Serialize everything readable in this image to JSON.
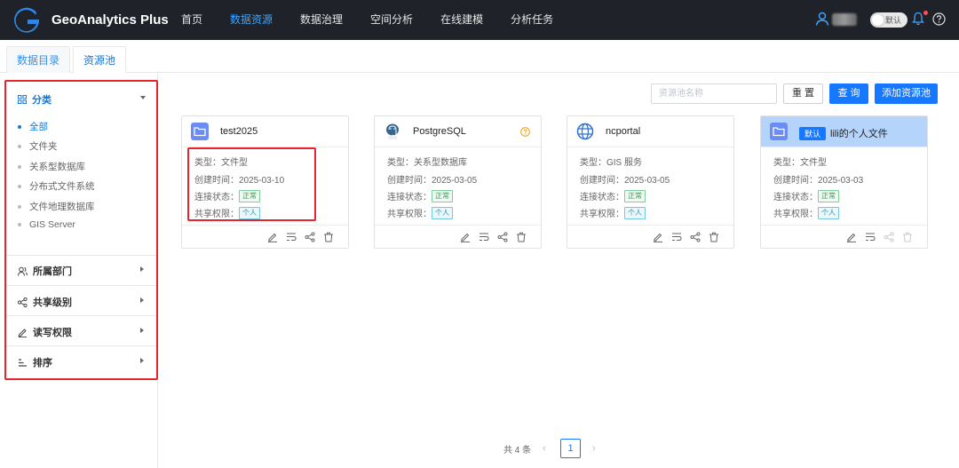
{
  "app": {
    "title": "GeoAnalytics Plus",
    "nav": [
      "首页",
      "数据资源",
      "数据治理",
      "空间分析",
      "在线建模",
      "分析任务"
    ],
    "nav_active_index": 1,
    "toggle_label": "默认"
  },
  "tabs": [
    "数据目录",
    "资源池"
  ],
  "tabs_active_index": 1,
  "sidebar": {
    "category": {
      "title": "分类",
      "items": [
        "全部",
        "文件夹",
        "关系型数据库",
        "分布式文件系统",
        "文件地理数据库",
        "GIS Server"
      ],
      "active_index": 0
    },
    "sections": [
      "所属部门",
      "共享级别",
      "读写权限",
      "排序"
    ]
  },
  "toolbar": {
    "search_placeholder": "资源池名称",
    "reset_label": "重 置",
    "query_label": "查 询",
    "add_label": "添加资源池"
  },
  "cards": [
    {
      "title": "test2025",
      "icon": "folder-icon",
      "default_badge": "",
      "type": "类型：文件型",
      "created": "创建时间：2025-03-10",
      "status_label": "连接状态：",
      "status": "正常",
      "perm_label": "共享权限：",
      "perm": "个人"
    },
    {
      "title": "PostgreSQL",
      "icon": "postgresql-icon",
      "default_badge": "",
      "type": "类型：关系型数据库",
      "created": "创建时间：2025-03-05",
      "status_label": "连接状态：",
      "status": "正常",
      "perm_label": "共享权限：",
      "perm": "个人"
    },
    {
      "title": "ncportal",
      "icon": "globe-icon",
      "default_badge": "",
      "type": "类型：GIS 服务",
      "created": "创建时间：2025-03-05",
      "status_label": "连接状态：",
      "status": "正常",
      "perm_label": "共享权限：",
      "perm": "个人"
    },
    {
      "title": "lili的个人文件",
      "icon": "folder-icon",
      "default_badge": "默认",
      "type": "类型：文件型",
      "created": "创建时间：2025-03-03",
      "status_label": "连接状态：",
      "status": "正常",
      "perm_label": "共享权限：",
      "perm": "个人"
    }
  ],
  "pagination": {
    "total": "共 4 条",
    "current_page": "1",
    "prev": "‹",
    "next": "›"
  },
  "colors": {
    "topbar": "#1f2329",
    "accent": "#1677ff",
    "highlight": "#e5262c"
  }
}
